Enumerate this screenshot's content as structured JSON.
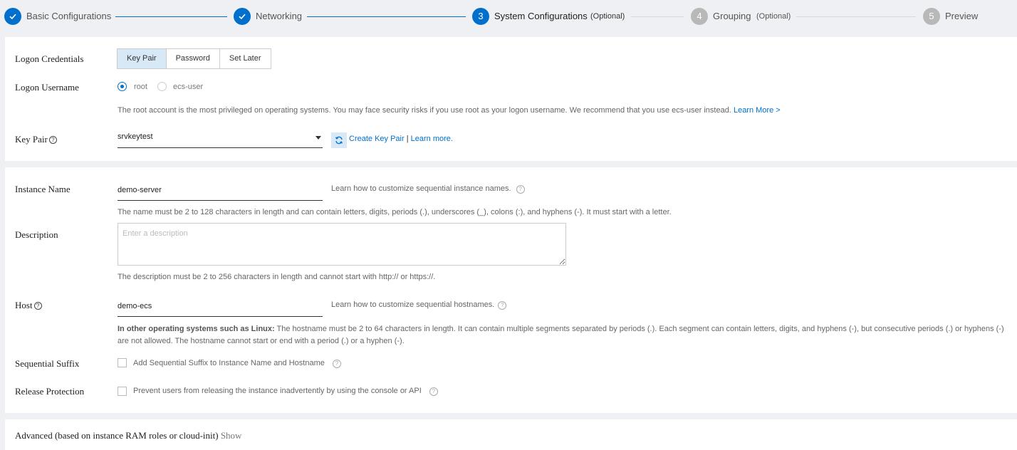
{
  "steps": [
    {
      "number": "1",
      "label": "Basic Configurations",
      "status": "done"
    },
    {
      "number": "2",
      "label": "Networking",
      "status": "done"
    },
    {
      "number": "3",
      "label": "System Configurations",
      "optional": "(Optional)",
      "status": "active"
    },
    {
      "number": "4",
      "label": "Grouping",
      "optional": "(Optional)",
      "status": "todo"
    },
    {
      "number": "5",
      "label": "Preview",
      "status": "todo"
    }
  ],
  "logon": {
    "credentials_label": "Logon Credentials",
    "credential_options": [
      "Key Pair",
      "Password",
      "Set Later"
    ],
    "selected_credential": "Key Pair",
    "username_label": "Logon Username",
    "username_options": [
      "root",
      "ecs-user"
    ],
    "selected_username": "root",
    "root_warning": "The root account is the most privileged on operating systems. You may face security risks if you use root as your logon username. We recommend that you use ecs-user instead.",
    "root_warning_link": "Learn More >",
    "key_pair_label": "Key Pair",
    "key_pair_value": "srvkeytest",
    "create_key_pair_link": "Create Key Pair",
    "separator": "|",
    "learn_more_link": "Learn more."
  },
  "instance": {
    "name_label": "Instance Name",
    "name_value": "demo-server",
    "name_help": "Learn how to customize sequential instance names.",
    "name_rule": "The name must be 2 to 128 characters in length and can contain letters, digits, periods (.), underscores (_), colons (:), and hyphens (-). It must start with a letter.",
    "description_label": "Description",
    "description_placeholder": "Enter a description",
    "description_rule": "The description must be 2 to 256 characters in length and cannot start with http:// or https://.",
    "host_label": "Host",
    "host_value": "demo-ecs",
    "host_help": "Learn how to customize sequential hostnames.",
    "host_rule_bold": "In other operating systems such as Linux:",
    "host_rule": "The hostname must be 2 to 64 characters in length. It can contain multiple segments separated by periods (.). Each segment can contain letters, digits, and hyphens (-), but consecutive periods (.) or hyphens (-) are not allowed. The hostname cannot start or end with a period (.) or a hyphen (-).",
    "suffix_label": "Sequential Suffix",
    "suffix_option": "Add Sequential Suffix to Instance Name and Hostname",
    "release_label": "Release Protection",
    "release_option": "Prevent users from releasing the instance inadvertently by using the console or API"
  },
  "advanced": {
    "label": "Advanced (based on instance RAM roles or cloud-init)",
    "toggle": "Show"
  },
  "help_glyph": "?",
  "colors": {
    "primary": "#0070cc",
    "pending": "#b8b8b8",
    "selected_bg": "#d7e8f7"
  }
}
